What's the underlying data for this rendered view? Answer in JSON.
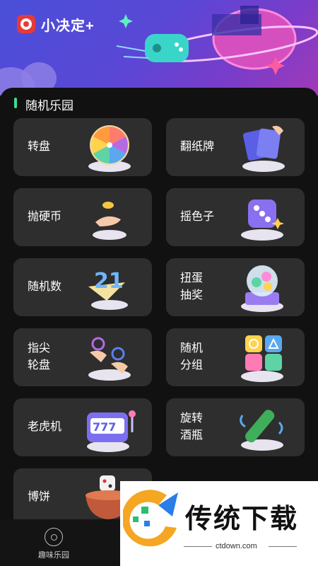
{
  "app": {
    "title": "小决定+"
  },
  "section": {
    "title": "随机乐园"
  },
  "cards": [
    {
      "label": "转盘"
    },
    {
      "label": "翻纸牌"
    },
    {
      "label": "抛硬币"
    },
    {
      "label": "摇色子"
    },
    {
      "label": "随机数",
      "art_text": "21"
    },
    {
      "line1": "扭蛋",
      "line2": "抽奖"
    },
    {
      "line1": "指尖",
      "line2": "轮盘"
    },
    {
      "line1": "随机",
      "line2": "分组"
    },
    {
      "label": "老虎机",
      "art_text": "777"
    },
    {
      "line1": "旋转",
      "line2": "酒瓶"
    },
    {
      "label": "博饼"
    }
  ],
  "bottom_nav": {
    "label": "趣味乐园"
  },
  "watermark": {
    "text": "传统下载",
    "url": "ctdown.com"
  },
  "colors": {
    "accent": "#3ddc97",
    "card_bg": "#2e2e2e",
    "page_bg": "#111111",
    "banner": "#5a47d6"
  }
}
